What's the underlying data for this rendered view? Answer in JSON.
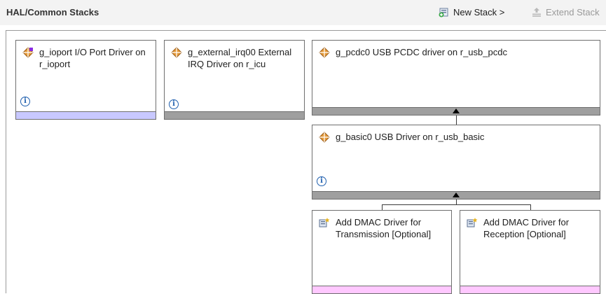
{
  "header": {
    "title": "HAL/Common Stacks",
    "new_stack": "New Stack >",
    "extend_stack": "Extend Stack"
  },
  "modules": {
    "ioport": "g_ioport I/O Port Driver on r_ioport",
    "external_irq": "g_external_irq00 External IRQ Driver on r_icu",
    "pcdc": "g_pcdc0 USB PCDC driver on r_usb_pcdc",
    "basic": "g_basic0 USB Driver on r_usb_basic",
    "dmac_tx": "Add DMAC Driver for Transmission [Optional]",
    "dmac_rx": "Add DMAC Driver for Reception [Optional]"
  },
  "info_glyph": "i",
  "icons": {
    "module": "module-diamond-icon",
    "add_module": "add-module-icon",
    "info": "info-icon",
    "new_stack": "new-stack-icon",
    "extend_stack": "extend-stack-icon"
  },
  "colors": {
    "header_bg": "#f3f3f3",
    "bar_gray": "#9f9f9f",
    "bar_blue": "#c8c8ff",
    "bar_pink": "#ffc8ff",
    "module_icon": "#c8781e",
    "info_blue": "#1f5fae"
  }
}
